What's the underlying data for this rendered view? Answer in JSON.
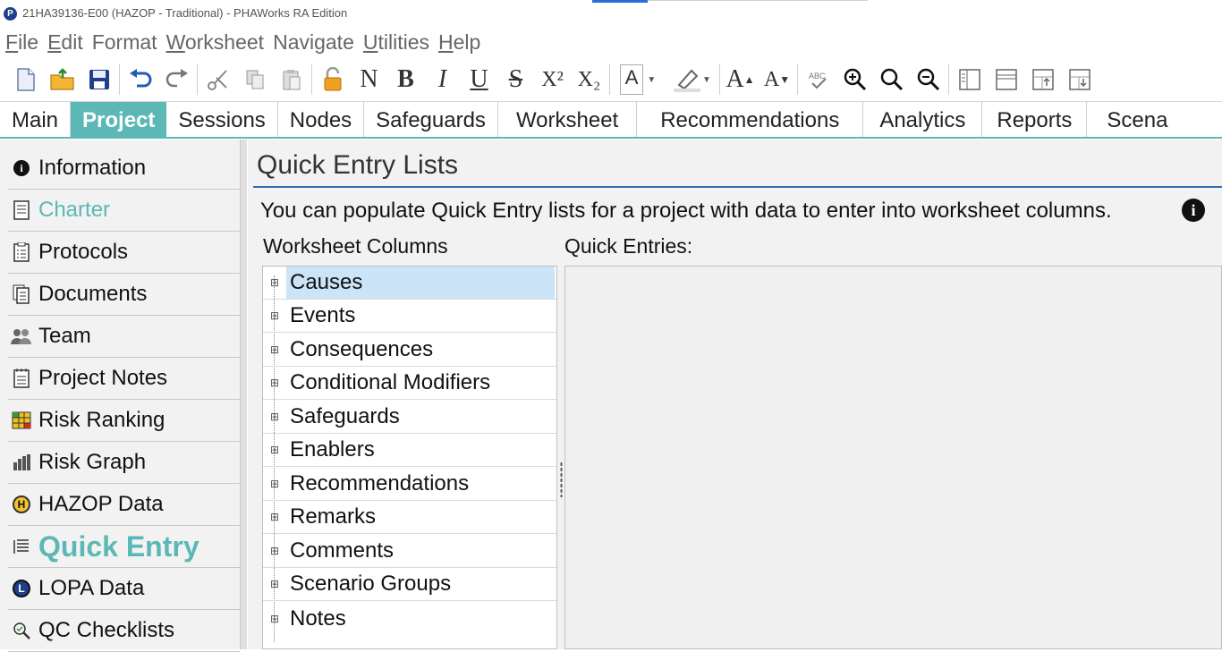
{
  "window": {
    "title": "21HA39136-E00 (HAZOP - Traditional) - PHAWorks RA Edition",
    "logo_letter": "P"
  },
  "menu": [
    {
      "label": "File",
      "u": "F",
      "rest": "ile"
    },
    {
      "label": "Edit",
      "u": "E",
      "rest": "dit"
    },
    {
      "label": "Format",
      "u": "",
      "rest": "Format"
    },
    {
      "label": "Worksheet",
      "u": "W",
      "rest": "orksheet"
    },
    {
      "label": "Navigate",
      "u": "",
      "rest": "Navigate"
    },
    {
      "label": "Utilities",
      "u": "U",
      "rest": "tilities"
    },
    {
      "label": "Help",
      "u": "H",
      "rest": "elp"
    }
  ],
  "toolbar": {
    "new": "new-document-icon",
    "open": "open-folder-icon",
    "save": "save-icon",
    "undo": "undo-icon",
    "redo": "redo-icon",
    "cut": "cut-icon",
    "copy": "copy-icon",
    "paste": "paste-icon",
    "lock": "lock-icon",
    "normal": "N",
    "bold": "B",
    "italic": "I",
    "underline": "U",
    "strike": "S",
    "superscript": "X²",
    "subscript": "X₂",
    "font_color": "A",
    "grow": "A",
    "shrink": "A"
  },
  "tabs": [
    "Main",
    "Project",
    "Sessions",
    "Nodes",
    "Safeguards",
    "Worksheet",
    "Recommendations",
    "Analytics",
    "Reports",
    "Scena"
  ],
  "active_tab": "Project",
  "sidebar": {
    "items": [
      {
        "label": "Information",
        "icon": "info-icon"
      },
      {
        "label": "Charter",
        "icon": "charter-icon"
      },
      {
        "label": "Protocols",
        "icon": "protocols-icon"
      },
      {
        "label": "Documents",
        "icon": "documents-icon"
      },
      {
        "label": "Team",
        "icon": "team-icon"
      },
      {
        "label": "Project Notes",
        "icon": "notes-icon"
      },
      {
        "label": "Risk Ranking",
        "icon": "risk-ranking-icon"
      },
      {
        "label": "Risk Graph",
        "icon": "risk-graph-icon"
      },
      {
        "label": "HAZOP Data",
        "icon": "hazop-icon"
      },
      {
        "label": "Quick Entry",
        "icon": "quick-entry-icon"
      },
      {
        "label": "LOPA Data",
        "icon": "lopa-icon"
      },
      {
        "label": "QC Checklists",
        "icon": "qc-icon"
      }
    ],
    "active": "Quick Entry",
    "muted": "Charter"
  },
  "main": {
    "title": "Quick Entry Lists",
    "description": "You can populate Quick Entry lists for a project with data to enter into worksheet columns.",
    "columns_label": "Worksheet Columns",
    "entries_label": "Quick Entries:",
    "tree": [
      "Causes",
      "Events",
      "Consequences",
      "Conditional Modifiers",
      "Safeguards",
      "Enablers",
      "Recommendations",
      "Remarks",
      "Comments",
      "Scenario Groups",
      "Notes"
    ],
    "selected": "Causes"
  }
}
